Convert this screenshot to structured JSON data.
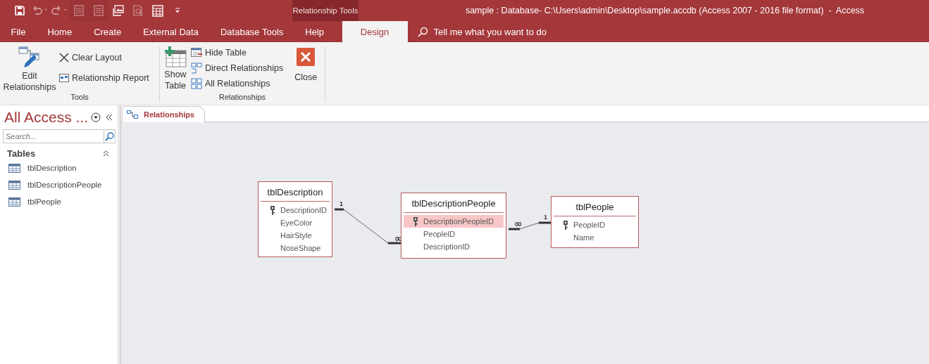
{
  "quick_access": [
    {
      "kind": "save",
      "disabled": false
    },
    {
      "kind": "undo",
      "disabled": true
    },
    {
      "kind": "redo",
      "disabled": true
    },
    {
      "kind": "form",
      "disabled": true
    },
    {
      "kind": "form",
      "disabled": true
    },
    {
      "kind": "picture",
      "disabled": false
    },
    {
      "kind": "preview",
      "disabled": true
    },
    {
      "kind": "grid",
      "disabled": false
    },
    {
      "kind": "more",
      "disabled": false
    }
  ],
  "contextual_group": "Relationship Tools",
  "window": {
    "title": "sample : Database- C:\\Users\\admin\\Desktop\\sample.accdb (Access 2007 - 2016 file format)  -  Access"
  },
  "tabs": [
    {
      "label": "File",
      "selected": false
    },
    {
      "label": "Home",
      "selected": false
    },
    {
      "label": "Create",
      "selected": false
    },
    {
      "label": "External Data",
      "selected": false
    },
    {
      "label": "Database Tools",
      "selected": false
    },
    {
      "label": "Help",
      "selected": false
    },
    {
      "label": "Design",
      "selected": true
    }
  ],
  "tell_me": {
    "placeholder": "Tell me what you want to do"
  },
  "ribbon": {
    "groups": [
      {
        "label": "Tools",
        "buttons": [
          {
            "label": "Edit Relationships",
            "kind": "large"
          },
          {
            "label": "Clear Layout",
            "kind": "small"
          },
          {
            "label": "Relationship Report",
            "kind": "small"
          }
        ]
      },
      {
        "label": "Relationships",
        "buttons": [
          {
            "label": "Show Table",
            "kind": "large"
          },
          {
            "label": "Hide Table",
            "kind": "small"
          },
          {
            "label": "Direct Relationships",
            "kind": "small"
          },
          {
            "label": "All Relationships",
            "kind": "small"
          },
          {
            "label": "Close",
            "kind": "large"
          }
        ]
      }
    ]
  },
  "nav": {
    "title": "All Access ...",
    "search": {
      "placeholder": "Search..."
    },
    "groups": [
      {
        "label": "Tables",
        "expanded": true,
        "items": [
          {
            "label": "tblDescription",
            "selected": false
          },
          {
            "label": "tblDescriptionPeople",
            "selected": false
          },
          {
            "label": "tblPeople",
            "selected": false
          }
        ]
      }
    ]
  },
  "document_tabs": [
    {
      "label": "Relationships",
      "selected": true
    }
  ],
  "diagram": {
    "tables": [
      {
        "name": "tblDescription",
        "fields": [
          {
            "name": "DescriptionID",
            "primary_key": true,
            "selected": false
          },
          {
            "name": "EyeColor",
            "primary_key": false,
            "selected": false
          },
          {
            "name": "HairStyle",
            "primary_key": false,
            "selected": false
          },
          {
            "name": "NoseShape",
            "primary_key": false,
            "selected": false
          }
        ]
      },
      {
        "name": "tblDescriptionPeople",
        "fields": [
          {
            "name": "DescriptionPeopleID",
            "primary_key": true,
            "selected": true
          },
          {
            "name": "PeopleID",
            "primary_key": false,
            "selected": false
          },
          {
            "name": "DescriptionID",
            "primary_key": false,
            "selected": false
          }
        ]
      },
      {
        "name": "tblPeople",
        "fields": [
          {
            "name": "PeopleID",
            "primary_key": true,
            "selected": false
          },
          {
            "name": "Name",
            "primary_key": false,
            "selected": false
          }
        ]
      }
    ],
    "relationships": [
      {
        "one_label": "1",
        "many_label": "∞"
      },
      {
        "one_label": "1",
        "many_label": "∞"
      }
    ]
  }
}
